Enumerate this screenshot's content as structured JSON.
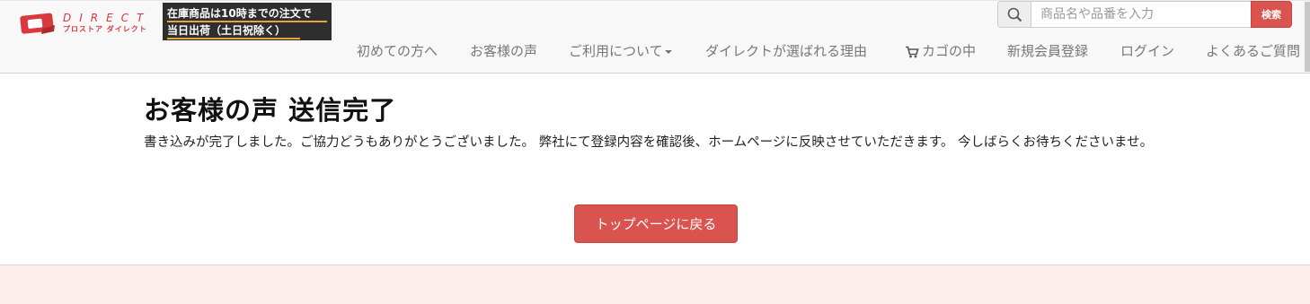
{
  "header": {
    "logo": {
      "en_text": "DIRECT",
      "jp_text": "プロストア ダイレクト",
      "brand_color": "#d9393c"
    },
    "notice": {
      "line1": "在庫商品は10時までの注文で",
      "line2": "当日出荷（土日祝除く）",
      "background": "#2e2e2e",
      "underline_color": "#e8a23c"
    },
    "search": {
      "icon": "search-icon",
      "placeholder": "商品名や品番を入力",
      "button_label": "検索"
    },
    "nav": [
      {
        "label": "初めての方へ"
      },
      {
        "label": "お客様の声"
      },
      {
        "label": "ご利用について",
        "dropdown": true
      },
      {
        "label": "ダイレクトが選ばれる理由"
      },
      {
        "label": "カゴの中",
        "icon": "cart-icon"
      },
      {
        "label": "新規会員登録"
      },
      {
        "label": "ログイン"
      },
      {
        "label": "よくあるご質問"
      }
    ]
  },
  "main": {
    "title": "お客様の声 送信完了",
    "message": "書き込みが完了しました。ご協力どうもありがとうございました。 弊社にて登録内容を確認後、ホームページに反映させていただきます。 今しばらくお待ちくださいませ。",
    "back_button_label": "トップページに戻る"
  },
  "colors": {
    "accent": "#d9534f",
    "nav_text": "#777777",
    "footer_bg": "#fdecec"
  }
}
